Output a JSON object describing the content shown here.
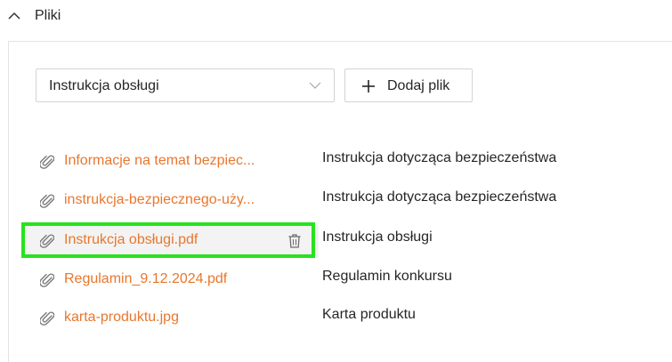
{
  "section": {
    "title": "Pliki",
    "expanded": true
  },
  "controls": {
    "select_value": "Instrukcja obsługi",
    "add_label": "Dodaj plik"
  },
  "files": [
    {
      "name": "Informacje na temat bezpiec...",
      "description": "Instrukcja dotycząca bezpieczeństwa"
    },
    {
      "name": "instrukcja-bezpiecznego-uży...",
      "description": "Instrukcja dotycząca bezpieczeństwa"
    },
    {
      "name": "Instrukcja obsługi.pdf",
      "description": "Instrukcja obsługi",
      "hovered": true
    },
    {
      "name": "Regulamin_9.12.2024.pdf",
      "description": "Regulamin konkursu"
    },
    {
      "name": "karta-produktu.jpg",
      "description": "Karta produktu"
    }
  ],
  "colors": {
    "link": "#e8772e",
    "highlight": "#27e31c",
    "text": "#262626"
  },
  "icons": {
    "collapse": "chevron-up-icon",
    "dropdown": "chevron-down-icon",
    "add": "plus-icon",
    "attachment": "paperclip-icon",
    "delete": "trash-icon"
  }
}
